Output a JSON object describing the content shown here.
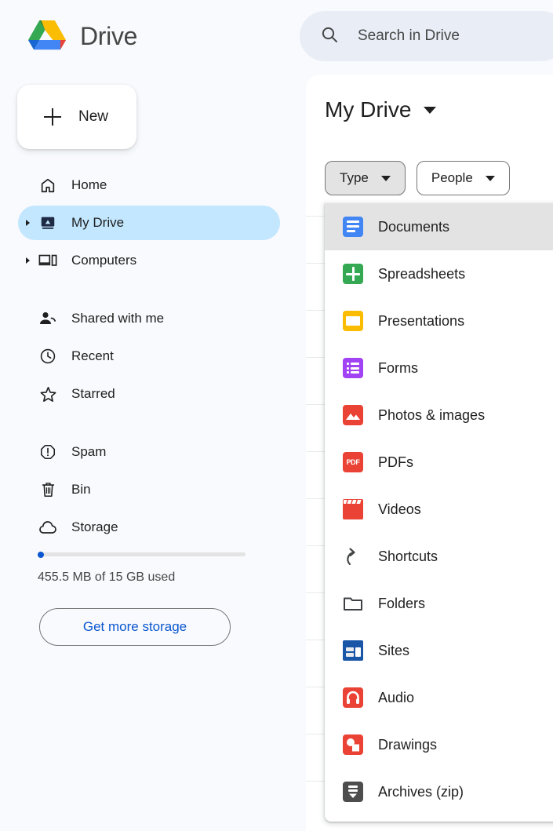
{
  "brand": {
    "name": "Drive",
    "logo_icon": "drive-logo-icon"
  },
  "new_button": {
    "label": "New",
    "icon": "plus-icon"
  },
  "sidebar": {
    "items": [
      {
        "label": "Home",
        "icon": "home-icon",
        "active": false,
        "expandable": false
      },
      {
        "label": "My Drive",
        "icon": "my-drive-icon",
        "active": true,
        "expandable": true
      },
      {
        "label": "Computers",
        "icon": "computer-icon",
        "active": false,
        "expandable": true
      },
      {
        "label": "Shared with me",
        "icon": "people-icon",
        "active": false,
        "expandable": false
      },
      {
        "label": "Recent",
        "icon": "clock-icon",
        "active": false,
        "expandable": false
      },
      {
        "label": "Starred",
        "icon": "star-icon",
        "active": false,
        "expandable": false
      },
      {
        "label": "Spam",
        "icon": "spam-icon",
        "active": false,
        "expandable": false
      },
      {
        "label": "Bin",
        "icon": "trash-icon",
        "active": false,
        "expandable": false
      },
      {
        "label": "Storage",
        "icon": "cloud-icon",
        "active": false,
        "expandable": false
      }
    ],
    "storage": {
      "used_text": "455.5 MB of 15 GB used",
      "percent": 3,
      "button_label": "Get more storage",
      "fill_color": "#0b57d0",
      "track_color": "#e3e3e3"
    }
  },
  "search": {
    "placeholder": "Search in Drive",
    "value": "",
    "icon": "search-icon"
  },
  "main": {
    "title": "My Drive",
    "title_caret_icon": "caret-down-icon",
    "chips": [
      {
        "label": "Type",
        "open": true,
        "icon": "caret-down-icon"
      },
      {
        "label": "People",
        "open": false,
        "icon": "caret-down-icon"
      }
    ]
  },
  "type_menu": {
    "highlighted_index": 0,
    "highlight_color": "#e3e3e3",
    "items": [
      {
        "label": "Documents",
        "icon": "docs-icon",
        "color": "blue"
      },
      {
        "label": "Spreadsheets",
        "icon": "sheets-icon",
        "color": "green"
      },
      {
        "label": "Presentations",
        "icon": "slides-icon",
        "color": "yellow"
      },
      {
        "label": "Forms",
        "icon": "forms-icon",
        "color": "purple"
      },
      {
        "label": "Photos & images",
        "icon": "image-icon",
        "color": "red"
      },
      {
        "label": "PDFs",
        "icon": "pdf-icon",
        "color": "red"
      },
      {
        "label": "Videos",
        "icon": "video-icon",
        "color": "red"
      },
      {
        "label": "Shortcuts",
        "icon": "shortcut-icon",
        "color": "none"
      },
      {
        "label": "Folders",
        "icon": "folder-icon",
        "color": "none"
      },
      {
        "label": "Sites",
        "icon": "sites-icon",
        "color": "blue"
      },
      {
        "label": "Audio",
        "icon": "audio-icon",
        "color": "red"
      },
      {
        "label": "Drawings",
        "icon": "drawings-icon",
        "color": "red"
      },
      {
        "label": "Archives (zip)",
        "icon": "archive-icon",
        "color": "dark"
      }
    ]
  },
  "file_list": {
    "rows": [
      "",
      "",
      "",
      "",
      "",
      "",
      "",
      "",
      "",
      "",
      "",
      "",
      ""
    ]
  }
}
